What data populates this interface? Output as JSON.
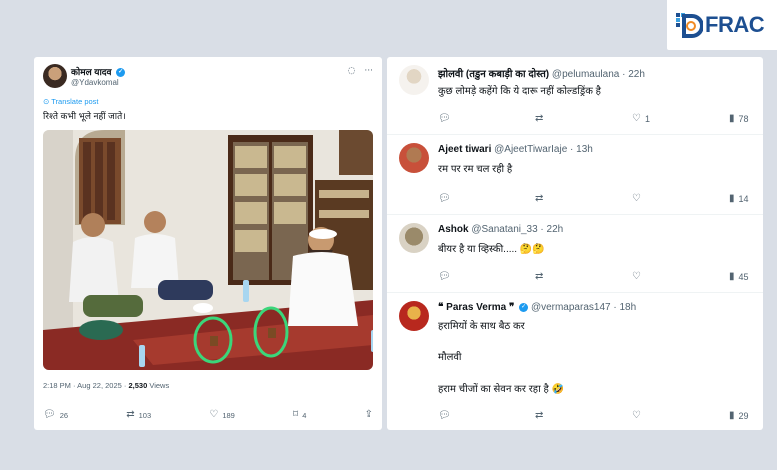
{
  "logo": {
    "text_a": "D",
    "text_b": "FRAC",
    "icon": "dfrac-logo-icon"
  },
  "post": {
    "author_name": "कोमल यादव",
    "handle": "@Ydavkomal",
    "translate": "Translate post",
    "text": "रिश्ते कभी भूले नहीं जाते।",
    "timestamp": "2:18 PM · Aug 22, 2025 · ",
    "views": "2,530",
    "views_label": " Views",
    "actions": {
      "replies": "26",
      "reposts": "103",
      "likes": "189",
      "bookmarks": "4"
    }
  },
  "replies": [
    {
      "name": "झोलवी (तडुन कबाड़ी का दोस्त)",
      "handle": "@pelumaulana · 22h",
      "text": "कुछ लोमड़े कहेंगे कि ये दारू नहीं कोल्डड्रिंक है",
      "likes": "1",
      "views": "78"
    },
    {
      "name": "Ajeet tiwari",
      "handle": "@AjeetTiwarIaje · 13h",
      "text": "रम पर रम चल रही है",
      "likes": "",
      "views": "14"
    },
    {
      "name": "Ashok",
      "handle": "@Sanatani_33 · 22h",
      "text": "बीयर है या व्हिस्की..... 🤔🤔",
      "likes": "",
      "views": "45"
    },
    {
      "name": "❝ Paras Verma ❞",
      "handle": "@vermaparas147 · 18h",
      "line1": "हरामियों के साथ बैठ कर",
      "line2": "मौलवी",
      "line3": "हराम चीजों का सेवन कर रहा है 🤣",
      "likes": "",
      "views": "29"
    }
  ]
}
